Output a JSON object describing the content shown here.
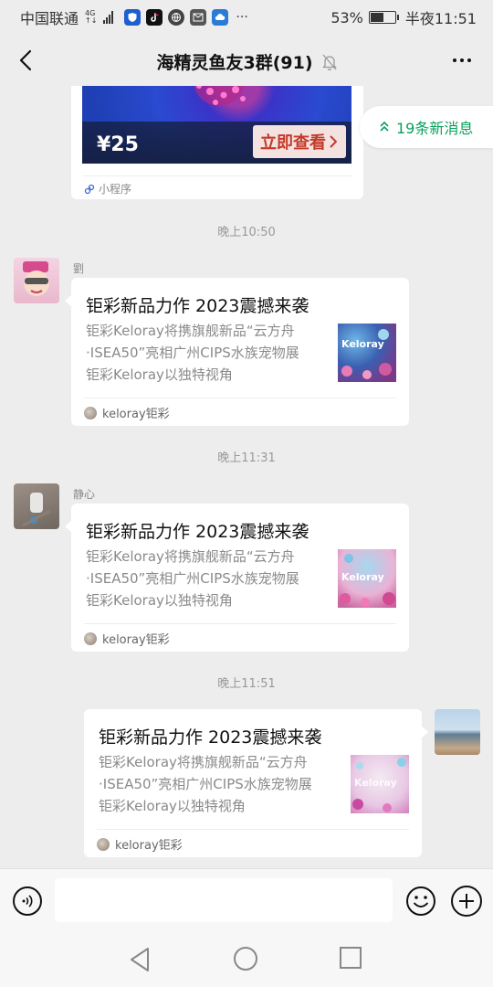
{
  "status_bar": {
    "carrier": "中国联通",
    "network_top": "4G",
    "network_bottom": "↑↓",
    "battery_percent": "53%",
    "battery_level": 0.53,
    "time": "半夜11:51",
    "more": "···"
  },
  "header": {
    "title": "海精灵鱼友3群(91)"
  },
  "new_messages": {
    "label": "19条新消息"
  },
  "mini_program_card": {
    "price": "¥25",
    "cta": "立即查看",
    "footer": "小程序"
  },
  "messages": [
    {
      "timestamp": "晚上10:50",
      "sender": "劉",
      "title": "钜彩新品力作 2023震撼来袭",
      "desc_lines": [
        "钜彩Keloray将携旗舰新品“云方舟",
        "·ISEA50”亮相广州CIPS水族宠物展",
        "钜彩Keloray以独特视角"
      ],
      "source": "keloray钜彩",
      "thumb_text": "Keloray"
    },
    {
      "timestamp": "晚上11:31",
      "sender": "静心",
      "title": "钜彩新品力作 2023震撼来袭",
      "desc_lines": [
        "钜彩Keloray将携旗舰新品“云方舟",
        "·ISEA50”亮相广州CIPS水族宠物展",
        "钜彩Keloray以独特视角"
      ],
      "source": "keloray钜彩",
      "thumb_text": "Keloray"
    },
    {
      "timestamp": "晚上11:51",
      "sender": "",
      "title": "钜彩新品力作 2023震撼来袭",
      "desc_lines": [
        "钜彩Keloray将携旗舰新品“云方舟",
        "·ISEA50”亮相广州CIPS水族宠物展",
        "钜彩Keloray以独特视角"
      ],
      "source": "keloray钜彩",
      "thumb_text": "Keloray"
    }
  ],
  "icons": {
    "back": "back-arrow-icon",
    "more": "more-dots-icon",
    "mute": "mute-bell-icon",
    "voice": "voice-icon",
    "emoji": "emoji-icon",
    "plus": "plus-icon"
  },
  "colors": {
    "accent_green": "#07a15a",
    "cta_red": "#c43a2a",
    "background": "#ededed"
  }
}
